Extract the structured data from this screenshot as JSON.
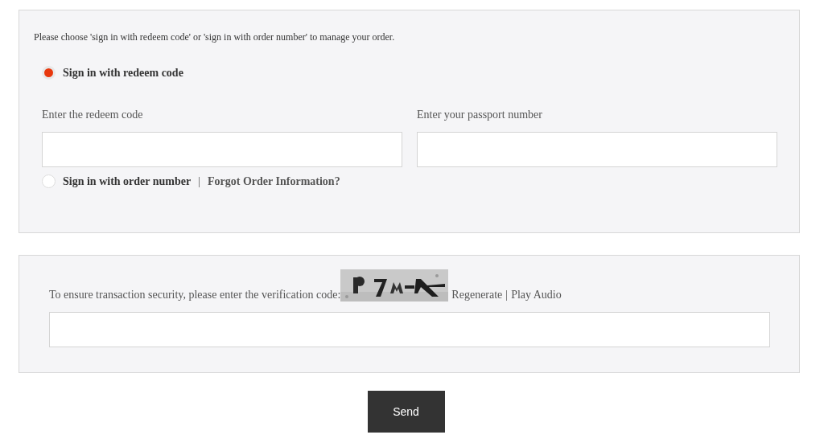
{
  "intro": "Please choose 'sign in with redeem code' or 'sign in with order number' to manage your order.",
  "sign_in_options": [
    {
      "label": "Sign in with redeem code",
      "selected": true
    },
    {
      "label": "Sign in with order number",
      "selected": false,
      "separator": "|",
      "link": "Forgot Order Information?"
    }
  ],
  "fields": [
    {
      "label": "Enter the redeem code"
    },
    {
      "label": "Enter your passport number"
    }
  ],
  "verification": {
    "prompt": "To ensure transaction security, please enter the verification code:",
    "links": [
      "Regenerate",
      "Play Audio"
    ],
    "separator": "|"
  },
  "send_button": "Send"
}
